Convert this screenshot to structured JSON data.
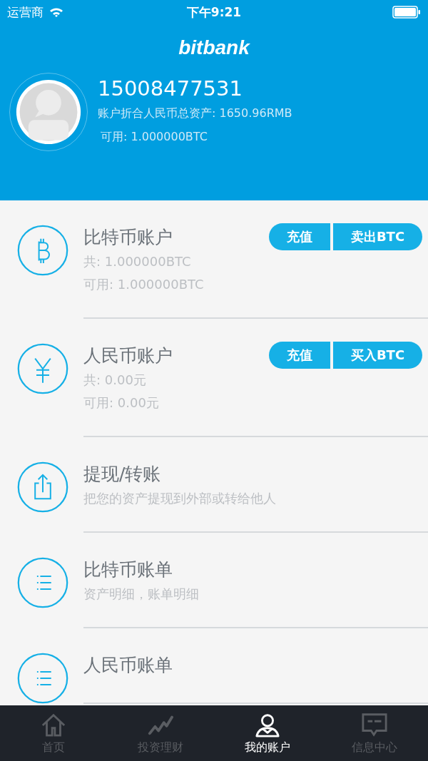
{
  "status_bar": {
    "carrier": "运营商",
    "time": "下午9:21"
  },
  "header": {
    "logo": "bitbank",
    "phone": "15008477531",
    "total_assets": "账户折合人民币总资产: 1650.96RMB",
    "available": "可用: 1.000000BTC"
  },
  "accounts": [
    {
      "kind": "bitcoin",
      "title": "比特币账户",
      "lines": [
        "共: 1.000000BTC",
        "可用: 1.000000BTC"
      ],
      "buttons": [
        "充值",
        "卖出BTC"
      ]
    },
    {
      "kind": "yuan",
      "title": "人民币账户",
      "lines": [
        "共:  0.00元",
        "可用: 0.00元"
      ],
      "buttons": [
        "充值",
        "买入BTC"
      ]
    },
    {
      "kind": "upload",
      "title": "提现/转账",
      "lines": [
        "把您的资产提现到外部或转给他人"
      ]
    },
    {
      "kind": "list",
      "title": "比特币账单",
      "lines": [
        "资产明细，账单明细"
      ]
    },
    {
      "kind": "list",
      "title": "人民币账单"
    }
  ],
  "tab_bar": [
    {
      "kind": "home",
      "label": "首页",
      "selected": false
    },
    {
      "kind": "chart",
      "label": "投资理财",
      "selected": false
    },
    {
      "kind": "person",
      "label": "我的账户",
      "selected": true
    },
    {
      "kind": "message",
      "label": "信息中心",
      "selected": false
    }
  ]
}
